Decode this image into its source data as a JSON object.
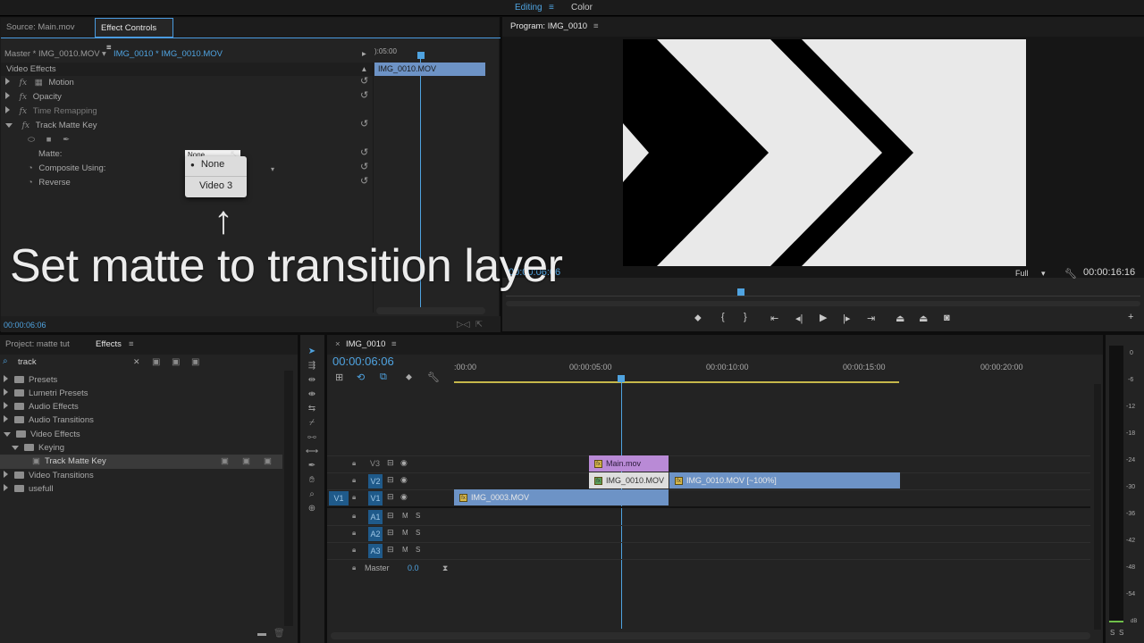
{
  "workspace": {
    "editing": "Editing",
    "menu_icon": "≡",
    "color": "Color"
  },
  "source_panel": {
    "tab_source": "Source: Main.mov",
    "tab_effect_controls": "Effect Controls",
    "menu_icon": "≡"
  },
  "effect_controls": {
    "master_label": "Master * IMG_0010.MOV",
    "clip_label": "IMG_0010 * IMG_0010.MOV",
    "ruler_time": "):05:00",
    "clip_bar": "IMG_0010.MOV",
    "section": "Video Effects",
    "effects": [
      {
        "name": "Motion"
      },
      {
        "name": "Opacity"
      },
      {
        "name": "Time Remapping"
      },
      {
        "name": "Track Matte Key"
      }
    ],
    "matte_label": "Matte:",
    "matte_value": "None",
    "composite_label": "Composite Using:",
    "reverse_label": "Reverse",
    "dropdown_options": [
      "None",
      "Video 3"
    ],
    "timecode": "00:00:06:06"
  },
  "overlay_caption": "Set matte to transition layer",
  "program": {
    "title": "Program: IMG_0010",
    "menu_icon": "≡",
    "timecode_left": "00:00:06:06",
    "fit": "Full",
    "timecode_right": "00:00:16:16"
  },
  "project_panel": {
    "tab_project": "Project: matte tut",
    "tab_effects": "Effects",
    "menu_icon": "≡",
    "search_value": "track",
    "clear": "✕",
    "tree": [
      {
        "label": "Presets",
        "level": 0,
        "open": false
      },
      {
        "label": "Lumetri Presets",
        "level": 0,
        "open": false
      },
      {
        "label": "Audio Effects",
        "level": 0,
        "open": false
      },
      {
        "label": "Audio Transitions",
        "level": 0,
        "open": false
      },
      {
        "label": "Video Effects",
        "level": 0,
        "open": true
      },
      {
        "label": "Keying",
        "level": 1,
        "open": true
      },
      {
        "label": "Track Matte Key",
        "level": 2,
        "open": false
      },
      {
        "label": "Video Transitions",
        "level": 0,
        "open": false
      },
      {
        "label": "usefull",
        "level": 0,
        "open": false
      }
    ]
  },
  "timeline": {
    "close": "×",
    "sequence_name": "IMG_0010",
    "menu_icon": "≡",
    "timecode": "00:00:06:06",
    "ruler": [
      ":00:00",
      "00:00:05:00",
      "00:00:10:00",
      "00:00:15:00",
      "00:00:20:00"
    ],
    "tracks": {
      "v3": "V3",
      "v2": "V2",
      "v1_src": "V1",
      "v1": "V1",
      "a1": "A1",
      "a2": "A2",
      "a3": "A3",
      "m": "M",
      "s": "S",
      "master": "Master",
      "master_value": "0.0"
    },
    "clips": {
      "main": "Main.mov",
      "img10a": "IMG_0010.MOV",
      "img10b": "IMG_0010.MOV [~100%]",
      "img03": "IMG_0003.MOV"
    }
  },
  "meter": {
    "scale": [
      "0",
      "-6",
      "-12",
      "-18",
      "-24",
      "-30",
      "-36",
      "-42",
      "-48",
      "-54"
    ],
    "unit": "dB",
    "s1": "S",
    "s2": "S"
  }
}
